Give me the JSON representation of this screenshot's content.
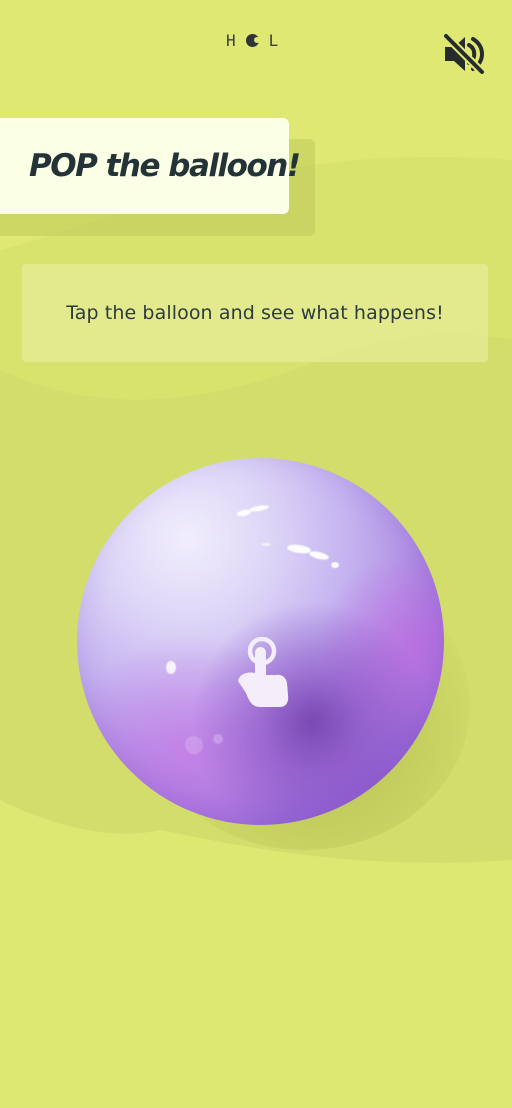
{
  "header": {
    "logo_left": "H",
    "logo_right": "L",
    "logo_icon": "circle-logo-icon",
    "sound_icon": "sound-muted-icon"
  },
  "title": {
    "text": "POP the balloon!"
  },
  "instruction": {
    "text": "Tap the balloon and see what happens!"
  },
  "balloon": {
    "icon": "tap-hand-icon"
  },
  "colors": {
    "background": "#dfe872",
    "title_card": "#fbffe6",
    "title_text": "#243337",
    "balloon_light": "#f1eefc",
    "balloon_dark": "#7a45b8"
  }
}
